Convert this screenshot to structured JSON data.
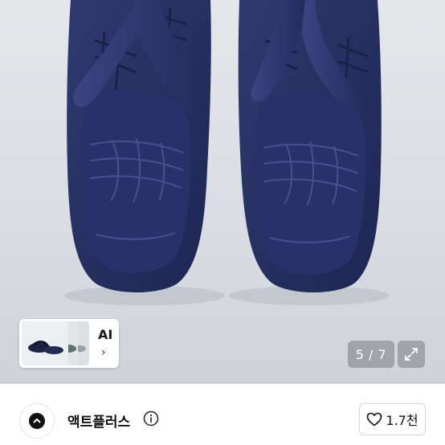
{
  "product_image": {
    "subject": "navy-sandals-photo",
    "colors": {
      "sandal": "#2b3566",
      "sandal_dark": "#1c2550",
      "background": "#dcdfe4"
    }
  },
  "ai_suggestion": {
    "label": "AI",
    "chevron": "›"
  },
  "gallery": {
    "pager_text": "5 / 7",
    "expand_icon": "expand-arrows-icon"
  },
  "seller": {
    "name": "액트플러스",
    "avatar_icon": "chevron-up-in-circle-icon",
    "info_icon": "info-circle-icon"
  },
  "like": {
    "icon": "heart-outline-icon",
    "count": "1.7천"
  }
}
